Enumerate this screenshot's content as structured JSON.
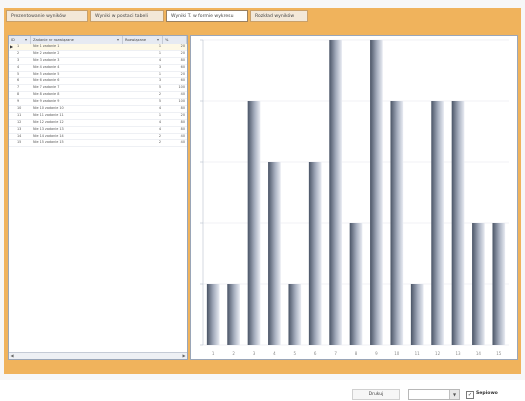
{
  "tabs": [
    {
      "label": "Prezentowanie wyników"
    },
    {
      "label": "Wyniki w postaci tabeli"
    },
    {
      "label": "Wyniki T. w formie wykresu"
    },
    {
      "label": "Rozkład wyników"
    }
  ],
  "grid": {
    "columns": [
      {
        "label": "ID"
      },
      {
        "label": "Zadanie nr rozwiązane"
      },
      {
        "label": "Rozwiązane"
      },
      {
        "label": "%"
      }
    ],
    "rows": [
      {
        "id": "1",
        "task": "Nie 1 zadanie 1",
        "solved": "1",
        "percent": "20"
      },
      {
        "id": "2",
        "task": "Nie 2 zadanie 2",
        "solved": "1",
        "percent": "20"
      },
      {
        "id": "3",
        "task": "Nie 3 zadanie 3",
        "solved": "4",
        "percent": "80"
      },
      {
        "id": "4",
        "task": "Nie 4 zadanie 4",
        "solved": "3",
        "percent": "60"
      },
      {
        "id": "5",
        "task": "Nie 5 zadanie 5",
        "solved": "1",
        "percent": "20"
      },
      {
        "id": "6",
        "task": "Nie 6 zadanie 6",
        "solved": "3",
        "percent": "60"
      },
      {
        "id": "7",
        "task": "Nie 7 zadanie 7",
        "solved": "5",
        "percent": "100"
      },
      {
        "id": "8",
        "task": "Nie 8 zadanie 8",
        "solved": "2",
        "percent": "40"
      },
      {
        "id": "9",
        "task": "Nie 9 zadanie 9",
        "solved": "5",
        "percent": "100"
      },
      {
        "id": "10",
        "task": "Nie 10 zadanie 10",
        "solved": "4",
        "percent": "80"
      },
      {
        "id": "11",
        "task": "Nie 11 zadanie 11",
        "solved": "1",
        "percent": "20"
      },
      {
        "id": "12",
        "task": "Nie 12 zadanie 12",
        "solved": "4",
        "percent": "80"
      },
      {
        "id": "13",
        "task": "Nie 13 zadanie 13",
        "solved": "4",
        "percent": "80"
      },
      {
        "id": "14",
        "task": "Nie 14 zadanie 14",
        "solved": "2",
        "percent": "40"
      },
      {
        "id": "15",
        "task": "Nie 15 zadanie 15",
        "solved": "2",
        "percent": "40"
      }
    ]
  },
  "chart_data": {
    "type": "bar",
    "categories": [
      "1",
      "2",
      "3",
      "4",
      "5",
      "6",
      "7",
      "8",
      "9",
      "10",
      "11",
      "12",
      "13",
      "14",
      "15"
    ],
    "values": [
      1,
      1,
      4,
      3,
      1,
      3,
      5,
      2,
      5,
      4,
      1,
      4,
      4,
      2,
      2
    ],
    "ylim": [
      0,
      5
    ],
    "grid": true
  },
  "footer": {
    "print_label": "Drukuj",
    "combo_value": "",
    "checkbox_checked": true,
    "checkbox_label": "Sepiowo",
    "checkbox_mark": "✓"
  },
  "icons": {
    "filter": "filter-icon",
    "row_marker": "▶",
    "scroll_left": "◀",
    "scroll_right": "▶",
    "dropdown": "▼"
  },
  "colors": {
    "accent": "#f0b35c",
    "bar_dark": "#4a5466",
    "bar_light": "#e8ebf2"
  }
}
